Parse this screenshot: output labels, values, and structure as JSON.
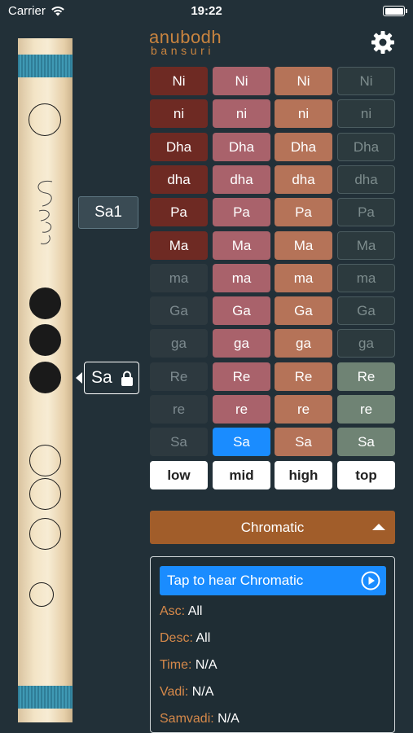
{
  "status_bar": {
    "carrier": "Carrier",
    "time": "19:22"
  },
  "app": {
    "logo_main": "anubodh",
    "logo_sub": "bansuri"
  },
  "flute": {
    "signature_text": "anubodh",
    "holes": [
      {
        "state": "open"
      },
      {
        "state": "closed"
      },
      {
        "state": "closed"
      },
      {
        "state": "closed"
      },
      {
        "state": "open"
      },
      {
        "state": "open"
      },
      {
        "state": "open"
      },
      {
        "state": "open"
      }
    ]
  },
  "side": {
    "pitch_label": "Sa1",
    "key_label": "Sa"
  },
  "grid": {
    "rows": [
      {
        "low": "Ni",
        "mid": "Ni",
        "high": "Ni",
        "top": "Ni"
      },
      {
        "low": "ni",
        "mid": "ni",
        "high": "ni",
        "top": "ni"
      },
      {
        "low": "Dha",
        "mid": "Dha",
        "high": "Dha",
        "top": "Dha"
      },
      {
        "low": "dha",
        "mid": "dha",
        "high": "dha",
        "top": "dha"
      },
      {
        "low": "Pa",
        "mid": "Pa",
        "high": "Pa",
        "top": "Pa"
      },
      {
        "low": "Ma",
        "mid": "Ma",
        "high": "Ma",
        "top": "Ma"
      },
      {
        "low": "ma",
        "mid": "ma",
        "high": "ma",
        "top": "ma"
      },
      {
        "low": "Ga",
        "mid": "Ga",
        "high": "Ga",
        "top": "Ga"
      },
      {
        "low": "ga",
        "mid": "ga",
        "high": "ga",
        "top": "ga"
      },
      {
        "low": "Re",
        "mid": "Re",
        "high": "Re",
        "top": "Re"
      },
      {
        "low": "re",
        "mid": "re",
        "high": "re",
        "top": "re"
      },
      {
        "low": "Sa",
        "mid": "Sa",
        "high": "Sa",
        "top": "Sa"
      }
    ],
    "octaves": [
      "low",
      "mid",
      "high",
      "top"
    ],
    "selected": {
      "row": 11,
      "col": "mid"
    }
  },
  "raga": {
    "name": "Chromatic",
    "hear_label": "Tap to hear Chromatic",
    "details": [
      {
        "key": "Asc:",
        "value": "All"
      },
      {
        "key": "Desc:",
        "value": "All"
      },
      {
        "key": "Time:",
        "value": "N/A"
      },
      {
        "key": "Vadi:",
        "value": "N/A"
      },
      {
        "key": "Samvadi:",
        "value": "N/A"
      }
    ]
  },
  "colors": {
    "background": "#223038",
    "accent_orange": "#a15d2a",
    "selected_blue": "#1a8cff",
    "low": "#6e2a23",
    "mid": "#a9626b",
    "high": "#b57358",
    "top": "#6f8374"
  }
}
